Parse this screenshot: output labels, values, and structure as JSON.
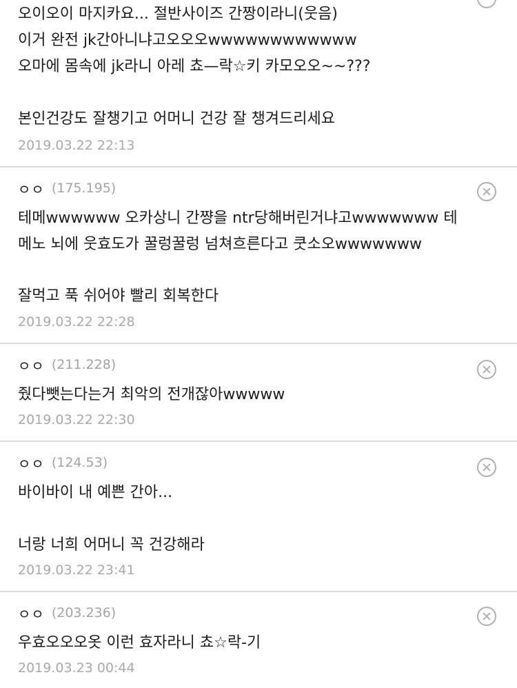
{
  "comments": [
    {
      "nick": "",
      "ip": "",
      "lines": [
        "오이오이 마지카요... 절반사이즈 간짱이라니(웃음)",
        "이거 완전 jk간아니냐고오오오wwwwwwwwwwww",
        "오마에 몸속에 jk라니 아레 쵸—락☆키 카모오오~~???",
        "",
        "본인건강도 잘챙기고 어머니 건강 잘 챙겨드리세요"
      ],
      "date": "2019.03.22 22:13"
    },
    {
      "nick": "ㅇㅇ",
      "ip": "(175.195)",
      "lines": [
        "테메wwwwww 오카상니 간쨩을 ntr당해버린거냐고wwwwwww 테",
        "메노 뇌에 웃효도가 꿀렁꿀렁 넘쳐흐른다고 쿳소오wwwwwww",
        "",
        "잘먹고 푹 쉬어야 빨리 회복한다"
      ],
      "date": "2019.03.22 22:28"
    },
    {
      "nick": "ㅇㅇ",
      "ip": "(211.228)",
      "lines": [
        "줬다뺏는다는거 최악의 전개잖아wwwww"
      ],
      "date": "2019.03.22 22:30"
    },
    {
      "nick": "ㅇㅇ",
      "ip": "(124.53)",
      "lines": [
        "바이바이 내 예쁜 간아...",
        "",
        "너랑 너희 어머니 꼭 건강해라"
      ],
      "date": "2019.03.22 23:41"
    },
    {
      "nick": "ㅇㅇ",
      "ip": "(203.236)",
      "lines": [
        "우효오오오옷 이런 효자라니 쵸☆락-기"
      ],
      "date": "2019.03.23 00:44"
    }
  ]
}
